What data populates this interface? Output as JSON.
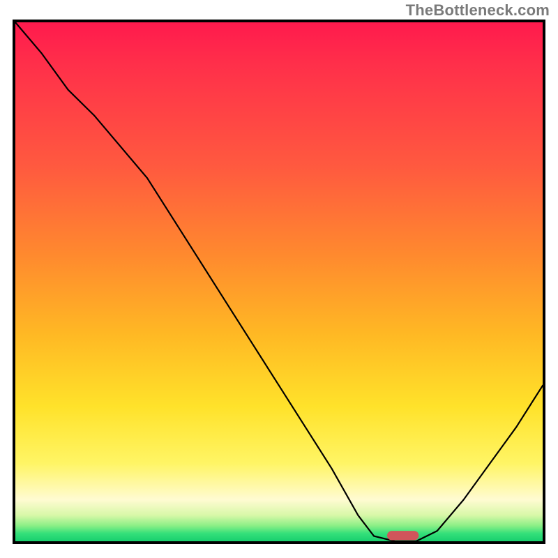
{
  "watermark": "TheBottleneck.com",
  "colors": {
    "curve": "#000000",
    "marker": "#d1555b",
    "gradient_stops": [
      "#ff1a4d",
      "#ff5a3f",
      "#ffb824",
      "#fff565",
      "#18cf6e"
    ]
  },
  "chart_data": {
    "type": "line",
    "title": "",
    "xlabel": "",
    "ylabel": "",
    "xlim": [
      0,
      1
    ],
    "ylim": [
      0,
      1
    ],
    "note": "Axes have no visible tick labels; x and y are normalized 0..1 estimated from pixel positions inside the plot border.",
    "series": [
      {
        "name": "bottleneck-curve",
        "x": [
          0.0,
          0.05,
          0.1,
          0.15,
          0.2,
          0.25,
          0.3,
          0.35,
          0.4,
          0.45,
          0.5,
          0.55,
          0.6,
          0.65,
          0.68,
          0.72,
          0.76,
          0.8,
          0.85,
          0.9,
          0.95,
          1.0
        ],
        "y": [
          1.0,
          0.94,
          0.87,
          0.82,
          0.76,
          0.7,
          0.62,
          0.54,
          0.46,
          0.38,
          0.3,
          0.22,
          0.14,
          0.05,
          0.01,
          0.0,
          0.0,
          0.02,
          0.08,
          0.15,
          0.22,
          0.3
        ]
      }
    ],
    "marker": {
      "name": "optimal-point-pill",
      "x_center": 0.735,
      "y_center": 0.011,
      "width": 0.06,
      "height": 0.018,
      "shape": "rounded-rect"
    },
    "background": {
      "type": "vertical-gradient",
      "description": "red at top through orange, yellow, pale, to green at bottom (good=bottom)"
    }
  }
}
